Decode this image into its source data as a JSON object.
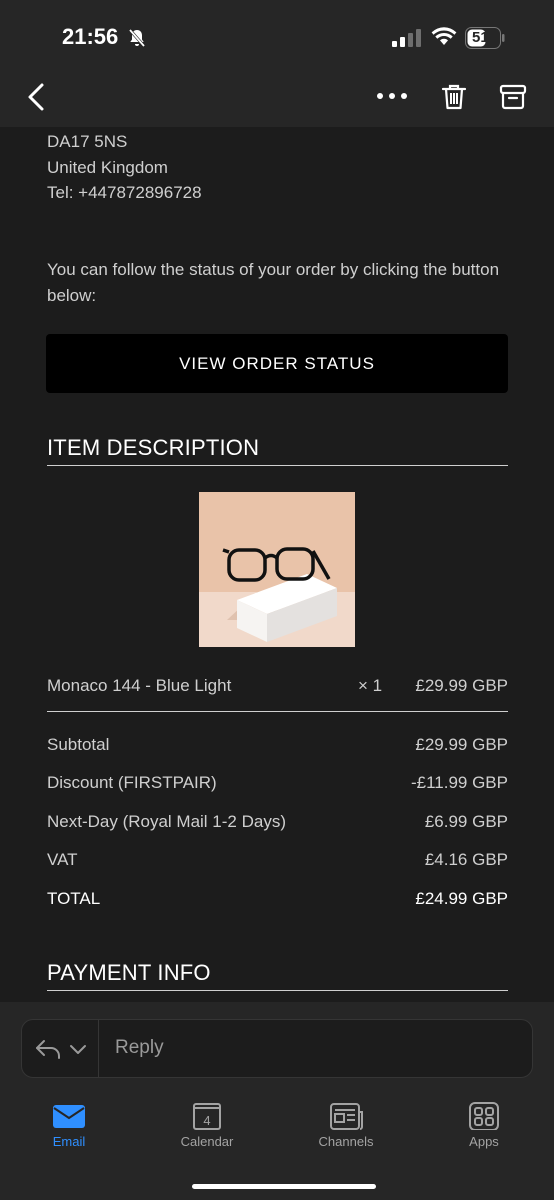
{
  "status_bar": {
    "time": "21:56",
    "battery": "51"
  },
  "address": {
    "line1": "DA17 5NS",
    "line2": "United Kingdom",
    "line3": "Tel: +447872896728"
  },
  "follow_text": "You can follow the status of your order by clicking the button below:",
  "order_button": "VIEW ORDER STATUS",
  "item_section": {
    "heading": "ITEM DESCRIPTION",
    "product": {
      "name": "Monaco 144 - Blue Light",
      "qty": "× 1",
      "price": "£29.99 GBP"
    }
  },
  "summary": [
    {
      "label": "Subtotal",
      "value": "£29.99 GBP"
    },
    {
      "label": "Discount (FIRSTPAIR)",
      "value": "-£11.99 GBP"
    },
    {
      "label": "Next-Day (Royal Mail 1-2 Days)",
      "value": "£6.99 GBP"
    },
    {
      "label": "VAT",
      "value": "£4.16 GBP"
    },
    {
      "label": "TOTAL",
      "value": "£24.99 GBP"
    }
  ],
  "payment_heading": "PAYMENT INFO",
  "reply": {
    "placeholder": "Reply"
  },
  "tabs": [
    {
      "label": "Email",
      "icon": "envelope-icon",
      "active": true
    },
    {
      "label": "Calendar",
      "icon": "calendar-icon",
      "date": "4"
    },
    {
      "label": "Channels",
      "icon": "channels-icon"
    },
    {
      "label": "Apps",
      "icon": "apps-grid-icon"
    }
  ],
  "colors": {
    "accent": "#2f8fff",
    "background": "#1c1c1c",
    "bar": "#262626"
  }
}
